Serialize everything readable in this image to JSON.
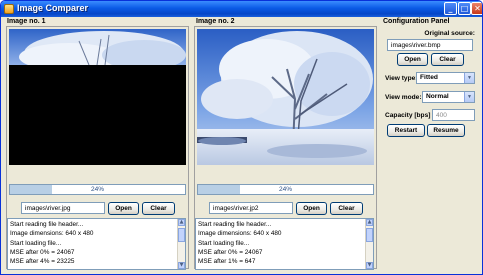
{
  "window": {
    "title": "Image Comparer",
    "minimize_glyph": "_",
    "maximize_glyph": "□",
    "close_glyph": "✕"
  },
  "left_panel": {
    "title": "Image no. 1",
    "progress": {
      "value": 0.24,
      "label": "24%"
    },
    "path_value": "images\\river.jpg",
    "open_label": "Open",
    "clear_label": "Clear",
    "log_lines": [
      "Start reading file header...",
      "Image dimensions: 640 x 480",
      "Start loading file...",
      "MSE after 0% = 24067",
      "MSE after 4% = 23225"
    ]
  },
  "right_panel": {
    "title": "Image no. 2",
    "progress": {
      "value": 0.24,
      "label": "24%"
    },
    "path_value": "images\\river.jp2",
    "open_label": "Open",
    "clear_label": "Clear",
    "log_lines": [
      "Start reading file header...",
      "Image dimensions: 640 x 480",
      "Start loading file...",
      "MSE after 0% = 24067",
      "MSE after 1% = 647"
    ]
  },
  "config_panel": {
    "title": "Configuration Panel",
    "source_label": "Original source:",
    "source_value": "images\\river.bmp",
    "open_label": "Open",
    "clear_label": "Clear",
    "view_type_label": "View type:",
    "view_type_value": "Fitted",
    "view_mode_label": "View mode:",
    "view_mode_value": "Normal",
    "capacity_label": "Capacity [bps] :",
    "capacity_value": "400",
    "restart_label": "Restart",
    "resume_label": "Resume"
  }
}
